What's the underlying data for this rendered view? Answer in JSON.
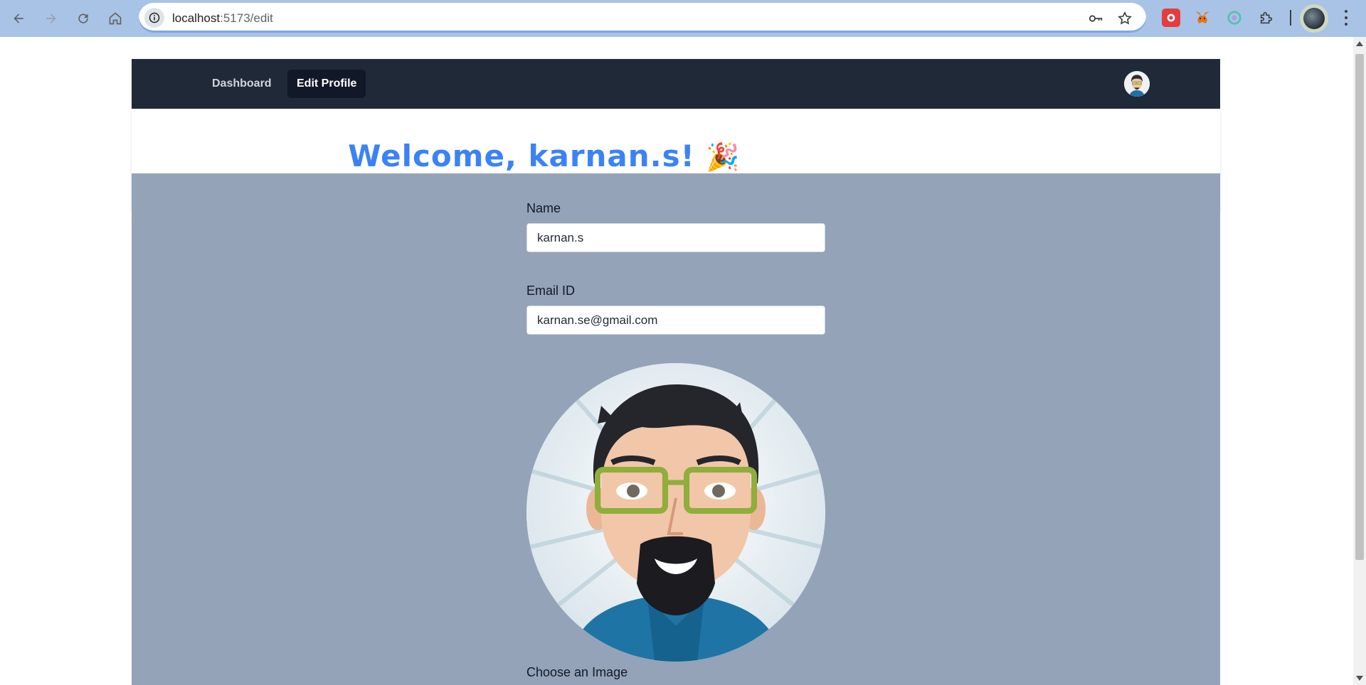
{
  "browser": {
    "url_host": "localhost",
    "url_path": ":5173/edit",
    "icons": [
      "back-icon",
      "forward-icon",
      "reload-icon",
      "home-icon",
      "site-info-icon",
      "password-key-icon",
      "bookmark-star-icon",
      "extension-red-icon",
      "metamask-fox-icon",
      "extension-circle-icon",
      "extensions-puzzle-icon",
      "profile-avatar-icon",
      "menu-icon"
    ]
  },
  "navbar": {
    "links": [
      {
        "label": "Dashboard",
        "active": false
      },
      {
        "label": "Edit Profile",
        "active": true
      }
    ],
    "avatar_icon": "user-avatar-icon"
  },
  "welcome": {
    "text": "Welcome, karnan.s!",
    "emoji": "🎉"
  },
  "form": {
    "name_label": "Name",
    "name_value": "karnan.s",
    "email_label": "Email ID",
    "email_value": "karnan.se@gmail.com",
    "image_label": "Choose an Image",
    "profile_image_icon": "cartoon-man-portrait"
  },
  "colors": {
    "navbar_bg": "#1f2937",
    "active_link_bg": "#111827",
    "welcome_text": "#3b82f6",
    "content_bg": "#94a3b8",
    "chrome_bg": "#a9c3e6"
  }
}
